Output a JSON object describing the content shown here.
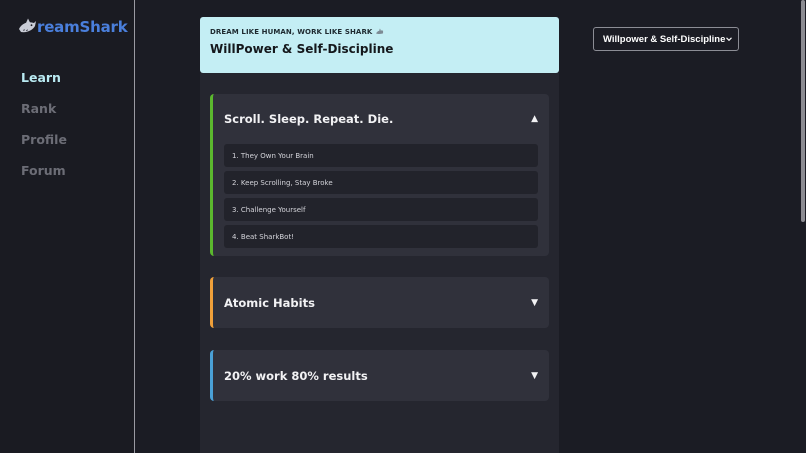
{
  "brand": {
    "name": "reamShark",
    "icon": "shark-logo-icon",
    "color": "#4a7fdc"
  },
  "nav": {
    "items": [
      {
        "label": "Learn",
        "active": true
      },
      {
        "label": "Rank",
        "active": false
      },
      {
        "label": "Profile",
        "active": false
      },
      {
        "label": "Forum",
        "active": false
      }
    ]
  },
  "header": {
    "tagline": "DREAM LIKE HUMAN, WORK LIKE SHARK",
    "tag_icon": "shark-emoji-icon",
    "title": "WillPower & Self-Discipline"
  },
  "sections": [
    {
      "title": "Scroll. Sleep. Repeat. Die.",
      "expanded": true,
      "accent": "#5bb82e",
      "chevron": "▲",
      "lessons": [
        "1. They Own Your Brain",
        "2. Keep Scrolling, Stay Broke",
        "3. Challenge Yourself",
        "4. Beat SharkBot!"
      ]
    },
    {
      "title": "Atomic Habits",
      "expanded": false,
      "accent": "#f0a03a",
      "chevron": "▼"
    },
    {
      "title": "20% work 80% results",
      "expanded": false,
      "accent": "#4aa0d6",
      "chevron": "▼"
    }
  ],
  "topic_select": {
    "selected": "Willpower & Self-Discipline"
  }
}
